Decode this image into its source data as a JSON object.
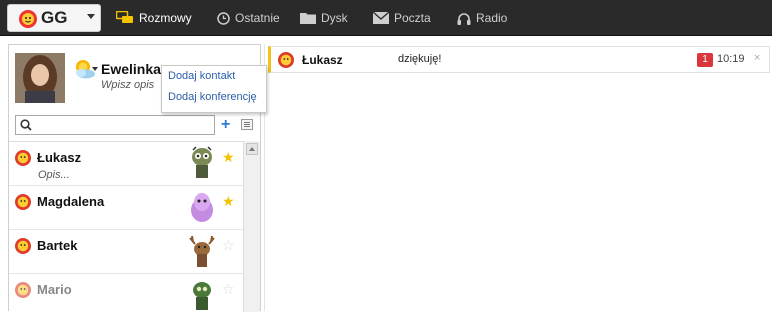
{
  "topbar": {
    "logo_text": "GG",
    "nav": [
      {
        "label": "Rozmowy",
        "icon": "chat-bubbles-icon"
      },
      {
        "label": "Ostatnie",
        "icon": "clock-icon"
      },
      {
        "label": "Dysk",
        "icon": "folder-icon"
      },
      {
        "label": "Poczta",
        "icon": "envelope-icon"
      },
      {
        "label": "Radio",
        "icon": "headphones-icon"
      }
    ]
  },
  "profile": {
    "name": "Ewelinka",
    "description_placeholder": "Wpisz opis"
  },
  "dropdown": {
    "items": [
      "Dodaj kontakt",
      "Dodaj konferencję"
    ]
  },
  "search": {
    "value": ""
  },
  "contacts": [
    {
      "name": "Łukasz",
      "description": "Opis...",
      "favorite": true
    },
    {
      "name": "Magdalena",
      "description": "",
      "favorite": true
    },
    {
      "name": "Bartek",
      "description": "",
      "favorite": false
    },
    {
      "name": "Mario",
      "description": "",
      "favorite": false
    }
  ],
  "conversation": {
    "name": "Łukasz",
    "message": "dziękuję!",
    "unread": "1",
    "time": "10:19",
    "close": "×"
  },
  "colors": {
    "topbar_bg": "#2a2a2a",
    "link": "#2b5fa5",
    "star_on": "#f2c200",
    "badge": "#d9363e",
    "active_stripe": "#f0c419"
  }
}
